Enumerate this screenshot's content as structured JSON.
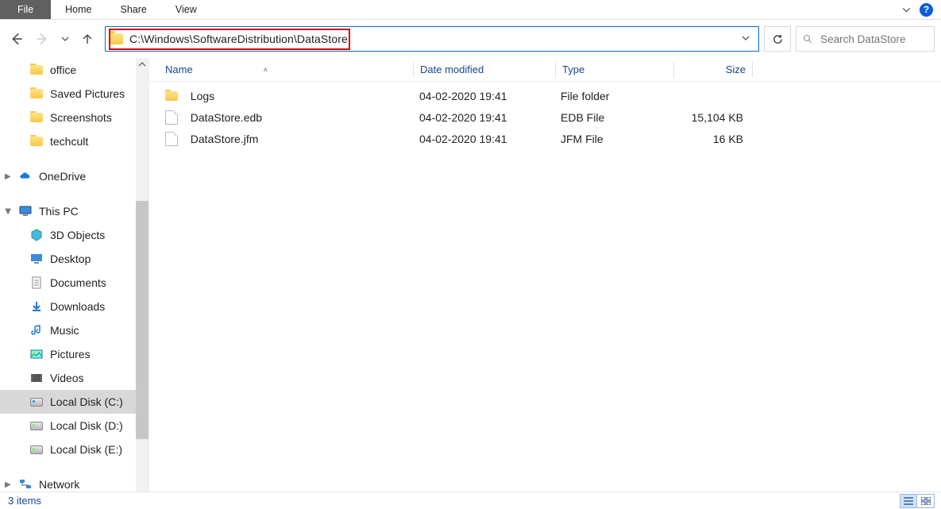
{
  "ribbon": {
    "file": "File",
    "tabs": [
      "Home",
      "Share",
      "View"
    ]
  },
  "address": {
    "path": "C:\\Windows\\SoftwareDistribution\\DataStore"
  },
  "search": {
    "placeholder": "Search DataStore"
  },
  "sidebar": {
    "quick": [
      {
        "label": "office"
      },
      {
        "label": "Saved Pictures"
      },
      {
        "label": "Screenshots"
      },
      {
        "label": "techcult"
      }
    ],
    "onedrive": "OneDrive",
    "thispc": {
      "label": "This PC",
      "items": [
        {
          "label": "3D Objects",
          "icon": "3d"
        },
        {
          "label": "Desktop",
          "icon": "desktop"
        },
        {
          "label": "Documents",
          "icon": "doc"
        },
        {
          "label": "Downloads",
          "icon": "down"
        },
        {
          "label": "Music",
          "icon": "music"
        },
        {
          "label": "Pictures",
          "icon": "pic"
        },
        {
          "label": "Videos",
          "icon": "video"
        },
        {
          "label": "Local Disk (C:)",
          "icon": "diskblue",
          "selected": true
        },
        {
          "label": "Local Disk (D:)",
          "icon": "disk"
        },
        {
          "label": "Local Disk (E:)",
          "icon": "disk"
        }
      ]
    },
    "network": "Network"
  },
  "columns": {
    "name": "Name",
    "date": "Date modified",
    "type": "Type",
    "size": "Size"
  },
  "rows": [
    {
      "name": "Logs",
      "date": "04-02-2020 19:41",
      "type": "File folder",
      "size": "",
      "icon": "folder"
    },
    {
      "name": "DataStore.edb",
      "date": "04-02-2020 19:41",
      "type": "EDB File",
      "size": "15,104 KB",
      "icon": "file"
    },
    {
      "name": "DataStore.jfm",
      "date": "04-02-2020 19:41",
      "type": "JFM File",
      "size": "16 KB",
      "icon": "file"
    }
  ],
  "status": "3 items"
}
